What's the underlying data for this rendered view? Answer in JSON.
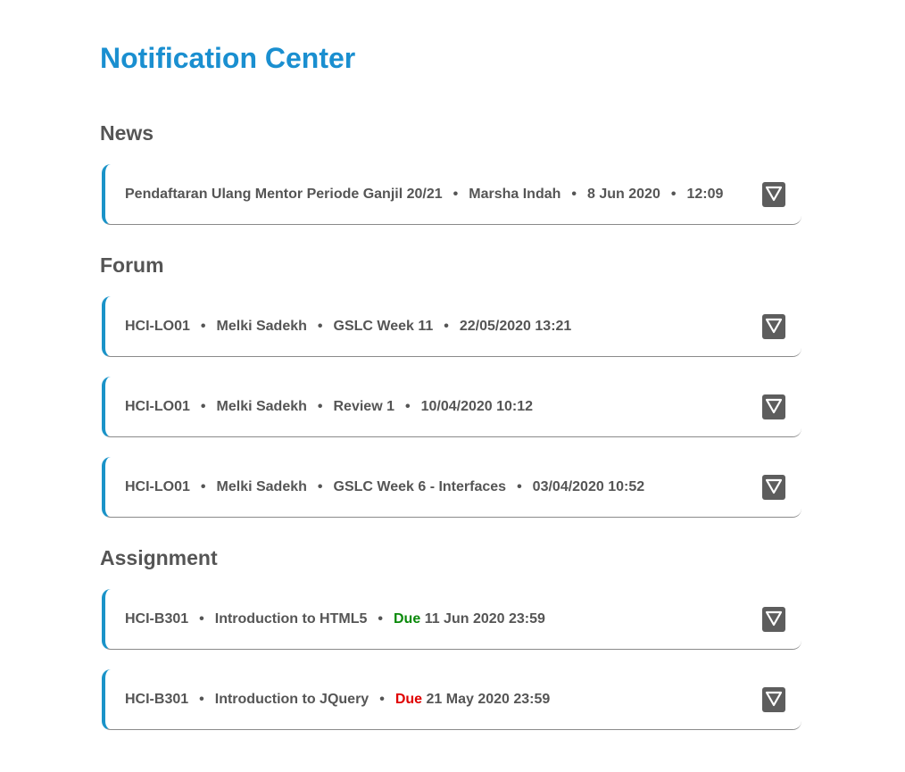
{
  "page": {
    "title": "Notification Center"
  },
  "separator": "•",
  "news": {
    "heading": "News",
    "items": [
      {
        "title": "Pendaftaran Ulang Mentor Periode Ganjil 20/21",
        "author": "Marsha Indah",
        "date": "8 Jun 2020",
        "time": "12:09"
      }
    ]
  },
  "forum": {
    "heading": "Forum",
    "items": [
      {
        "course": "HCI-LO01",
        "author": "Melki Sadekh",
        "topic": "GSLC Week 11",
        "datetime": "22/05/2020 13:21"
      },
      {
        "course": "HCI-LO01",
        "author": "Melki Sadekh",
        "topic": "Review 1",
        "datetime": "10/04/2020 10:12"
      },
      {
        "course": "HCI-LO01",
        "author": "Melki Sadekh",
        "topic": "GSLC Week 6 - Interfaces",
        "datetime": "03/04/2020 10:52"
      }
    ]
  },
  "assignment": {
    "heading": "Assignment",
    "due_label": "Due",
    "items": [
      {
        "course": "HCI-B301",
        "title": "Introduction to HTML5",
        "due": "11 Jun 2020 23:59",
        "due_color": "#0a8a0a"
      },
      {
        "course": "HCI-B301",
        "title": "Introduction to JQuery",
        "due": "21 May 2020 23:59",
        "due_color": "#e00000"
      }
    ]
  },
  "icons": {
    "expand": "triangle-down-icon"
  },
  "colors": {
    "accent": "#1a8fd0",
    "card_border": "#1a93c8",
    "text": "#555555",
    "button": "#5d5d5d"
  }
}
